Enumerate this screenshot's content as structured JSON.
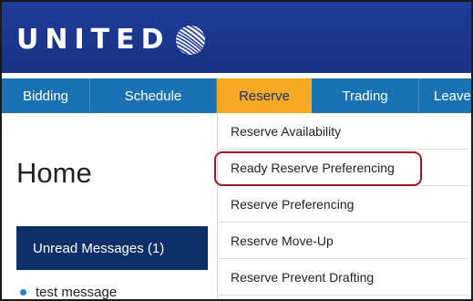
{
  "header": {
    "logo_text": "UNITED",
    "logo_icon": "united-globe-icon"
  },
  "nav": {
    "items": [
      {
        "label": "Bidding"
      },
      {
        "label": "Schedule"
      },
      {
        "label": "Reserve",
        "active": true
      },
      {
        "label": "Trading"
      },
      {
        "label": "Leave"
      }
    ]
  },
  "main": {
    "page_title": "Home",
    "messages_header": "Unread Messages (1)",
    "messages": [
      {
        "text": "test message"
      }
    ]
  },
  "dropdown": {
    "items": [
      {
        "label": "Reserve Availability"
      },
      {
        "label": "Ready Reserve Preferencing",
        "highlighted": true
      },
      {
        "label": "Reserve Preferencing"
      },
      {
        "label": "Reserve Move-Up"
      },
      {
        "label": "Reserve Prevent Drafting"
      }
    ]
  },
  "colors": {
    "header_bg": "#1f3b96",
    "nav_bg": "#1a72b3",
    "active_tab": "#f7a824",
    "messages_header_bg": "#0f2f69",
    "highlight_border": "#9a1b22"
  }
}
